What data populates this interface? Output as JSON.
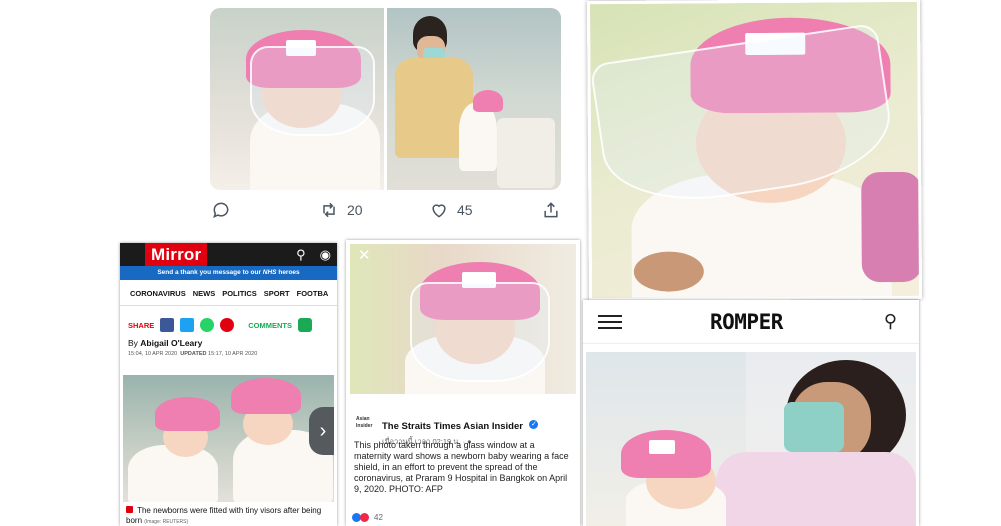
{
  "tweet": {
    "retweet_count": "20",
    "like_count": "45"
  },
  "mirror": {
    "logo": "Mirror",
    "banner_prefix": "Send a thank you message to our",
    "banner_nhs": "NHS",
    "banner_suffix": "heroes",
    "nav": [
      "CORONAVIRUS",
      "NEWS",
      "POLITICS",
      "SPORT",
      "FOOTBA"
    ],
    "share_label": "SHARE",
    "comments_label": "COMMENTS",
    "byline_prefix": "By",
    "author": "Abigail O'Leary",
    "published": "15:04, 10 APR 2020",
    "updated_label": "UPDATED",
    "updated": "15:17, 10 APR 2020",
    "caption": "The newborns were fitted with tiny visors after being born",
    "image_credit": "(Image: REUTERS)",
    "colors": {
      "brand": "#e1000f",
      "banner": "#1769c2"
    }
  },
  "straits": {
    "logo_text": "Asian Insider",
    "page_name": "The Straits Times Asian Insider",
    "timestamp": "เมื่อวานนี้ เวลา 02:19 น. · ",
    "body": "This photo taken through a glass window at a maternity ward shows a newborn baby wearing a face shield, in an effort to prevent the spread of the coronavirus, at Praram 9 Hospital in Bangkok on April 9, 2020. PHOTO: AFP",
    "reaction_count": "42"
  },
  "romper": {
    "logo": "ROMPER"
  }
}
